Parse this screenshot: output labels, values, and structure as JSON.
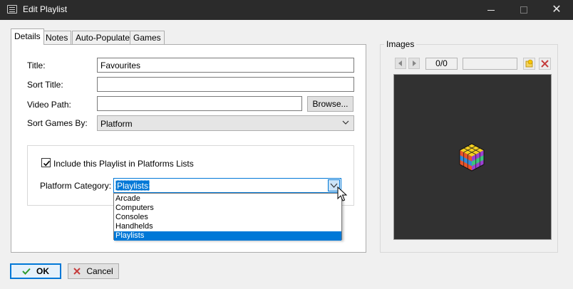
{
  "window": {
    "title": "Edit Playlist",
    "icon": "window-icon"
  },
  "tabs": [
    {
      "label": "Details",
      "active": true
    },
    {
      "label": "Notes",
      "active": false
    },
    {
      "label": "Auto-Populate",
      "active": false
    },
    {
      "label": "Games",
      "active": false
    }
  ],
  "details": {
    "title_label": "Title:",
    "title_value": "Favourites",
    "sort_title_label": "Sort Title:",
    "sort_title_value": "",
    "video_path_label": "Video Path:",
    "video_path_value": "",
    "browse_label": "Browse...",
    "sort_games_label": "Sort Games By:",
    "sort_games_value": "Platform",
    "include_checkbox_label": "Include this Playlist in Platforms Lists",
    "include_checked": true,
    "platform_category_label": "Platform Category:",
    "platform_category_value": "Playlists",
    "platform_category_options": [
      "Arcade",
      "Computers",
      "Consoles",
      "Handhelds",
      "Playlists"
    ],
    "platform_category_selected": "Playlists"
  },
  "images": {
    "legend": "Images",
    "counter": "0/0"
  },
  "footer": {
    "ok_label": "OK",
    "cancel_label": "Cancel"
  },
  "colors": {
    "accent": "#0078d7",
    "titlebar": "#2b2b2b",
    "preview_bg": "#313131"
  }
}
